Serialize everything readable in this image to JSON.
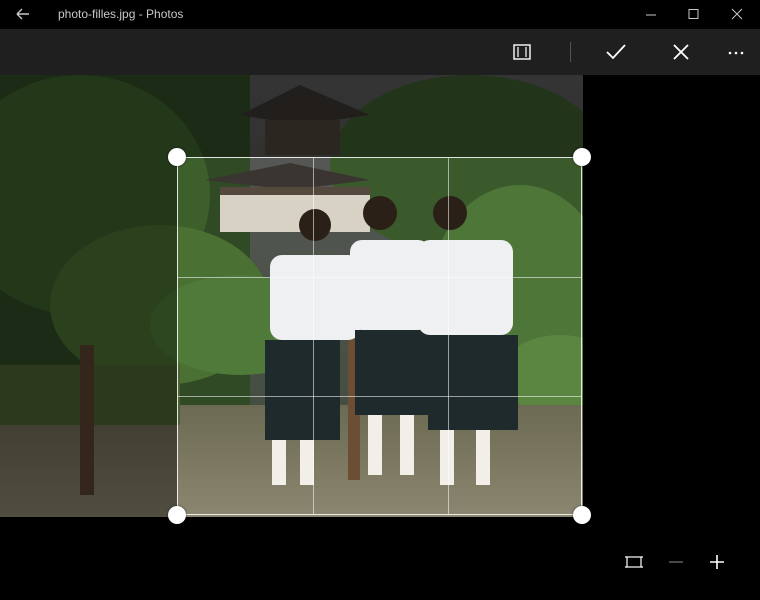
{
  "window": {
    "title": "photo-filles.jpg - Photos"
  },
  "toolbar": {
    "buttons": [
      {
        "name": "aspect-ratio",
        "icon": "aspect-ratio-icon"
      },
      {
        "name": "done",
        "icon": "checkmark-icon"
      },
      {
        "name": "cancel",
        "icon": "close-icon"
      },
      {
        "name": "more",
        "icon": "more-icon"
      }
    ]
  },
  "photo": {
    "description_icon": "photo-canvas"
  },
  "controls": {
    "zoom_icons": [
      "fit-icon",
      "zoom-out-icon",
      "zoom-in-icon"
    ]
  },
  "colors": {
    "titlebar": "#000000",
    "toolbar": "#1f1f1f",
    "background": "#000000",
    "crop_border": "#ffffff"
  }
}
